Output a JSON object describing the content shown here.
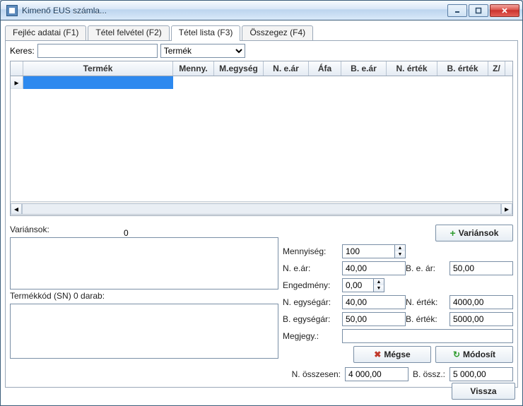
{
  "window": {
    "title": "Kimenő EUS számla..."
  },
  "tabs": [
    {
      "label": "Fejléc adatai (F1)"
    },
    {
      "label": "Tétel felvétel (F2)"
    },
    {
      "label": "Tétel lista (F3)"
    },
    {
      "label": "Összegez (F4)"
    }
  ],
  "search": {
    "label": "Keres:",
    "value": "",
    "filter": "Termék"
  },
  "grid": {
    "columns": [
      "Termék",
      "Menny.",
      "M.egység",
      "N. e.ár",
      "Áfa",
      "B. e.ár",
      "N. érték",
      "B. érték",
      "Z/"
    ]
  },
  "left": {
    "variansok_label": "Variánsok:",
    "zero": "0",
    "termekkod_label": "Termékkód (SN) 0 darab:"
  },
  "form": {
    "mennyiseg_label": "Mennyiség:",
    "mennyiseg": "100",
    "n_ear_label": "N. e.ár:",
    "n_ear": "40,00",
    "b_ear_label": "B. e. ár:",
    "b_ear": "50,00",
    "engedmeny_label": "Engedmény:",
    "engedmeny": "0,00",
    "n_egysegar_label": "N. egységár:",
    "n_egysegar": "40,00",
    "n_ertek_label": "N. érték:",
    "n_ertek": "4000,00",
    "b_egysegar_label": "B. egységár:",
    "b_egysegar": "50,00",
    "b_ertek_label": "B. érték:",
    "b_ertek": "5000,00",
    "megjegy_label": "Megjegy.:",
    "megjegy": ""
  },
  "buttons": {
    "varianok": "Variánsok",
    "megse": "Mégse",
    "modosit": "Módosít",
    "vissza": "Vissza"
  },
  "totals": {
    "n_osszesen_label": "N. összesen:",
    "n_osszesen": "4 000,00",
    "b_ossz_label": "B. össz.:",
    "b_ossz": "5 000,00"
  }
}
